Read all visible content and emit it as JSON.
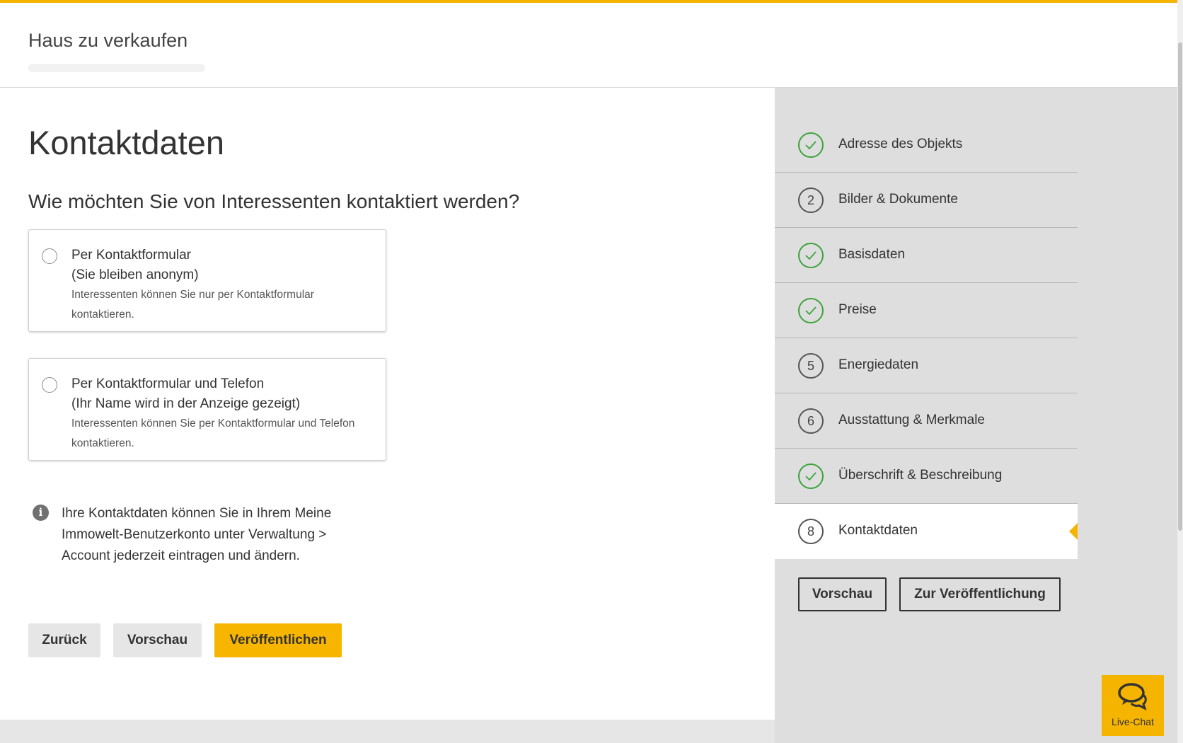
{
  "header": {
    "title": "Haus zu verkaufen"
  },
  "main": {
    "title": "Kontaktdaten",
    "question": "Wie möchten Sie von Interessenten kontaktiert werden?",
    "options": [
      {
        "line1": "Per Kontaktformular",
        "line2": "(Sie bleiben anonym)",
        "desc": "Interessenten können Sie nur per Kontaktformular kontaktieren."
      },
      {
        "line1": "Per Kontaktformular und Telefon",
        "line2": "(Ihr Name wird in der Anzeige gezeigt)",
        "desc": "Interessenten können Sie per Kontaktformular und Telefon kontaktieren."
      }
    ],
    "info": "Ihre Kontaktdaten können Sie in Ihrem Meine Immowelt-Benutzerkonto unter Verwaltung > Account jederzeit eintragen und ändern.",
    "buttons": {
      "back": "Zurück",
      "preview": "Vorschau",
      "publish": "Veröffentlichen"
    }
  },
  "sidebar": {
    "steps": [
      {
        "label": "Adresse des Objekts",
        "status": "done",
        "number": ""
      },
      {
        "label": "Bilder & Dokumente",
        "status": "open",
        "number": "2"
      },
      {
        "label": "Basisdaten",
        "status": "done",
        "number": ""
      },
      {
        "label": "Preise",
        "status": "done",
        "number": ""
      },
      {
        "label": "Energiedaten",
        "status": "open",
        "number": "5"
      },
      {
        "label": "Ausstattung & Merkmale",
        "status": "open",
        "number": "6"
      },
      {
        "label": "Überschrift & Beschreibung",
        "status": "done",
        "number": ""
      },
      {
        "label": "Kontaktdaten",
        "status": "active",
        "number": "8"
      }
    ],
    "preview_button": "Vorschau",
    "publish_button": "Zur Veröffentlichung"
  },
  "livechat": {
    "label": "Live-Chat"
  },
  "colors": {
    "accent": "#f5b400",
    "done": "#3ca33c"
  }
}
